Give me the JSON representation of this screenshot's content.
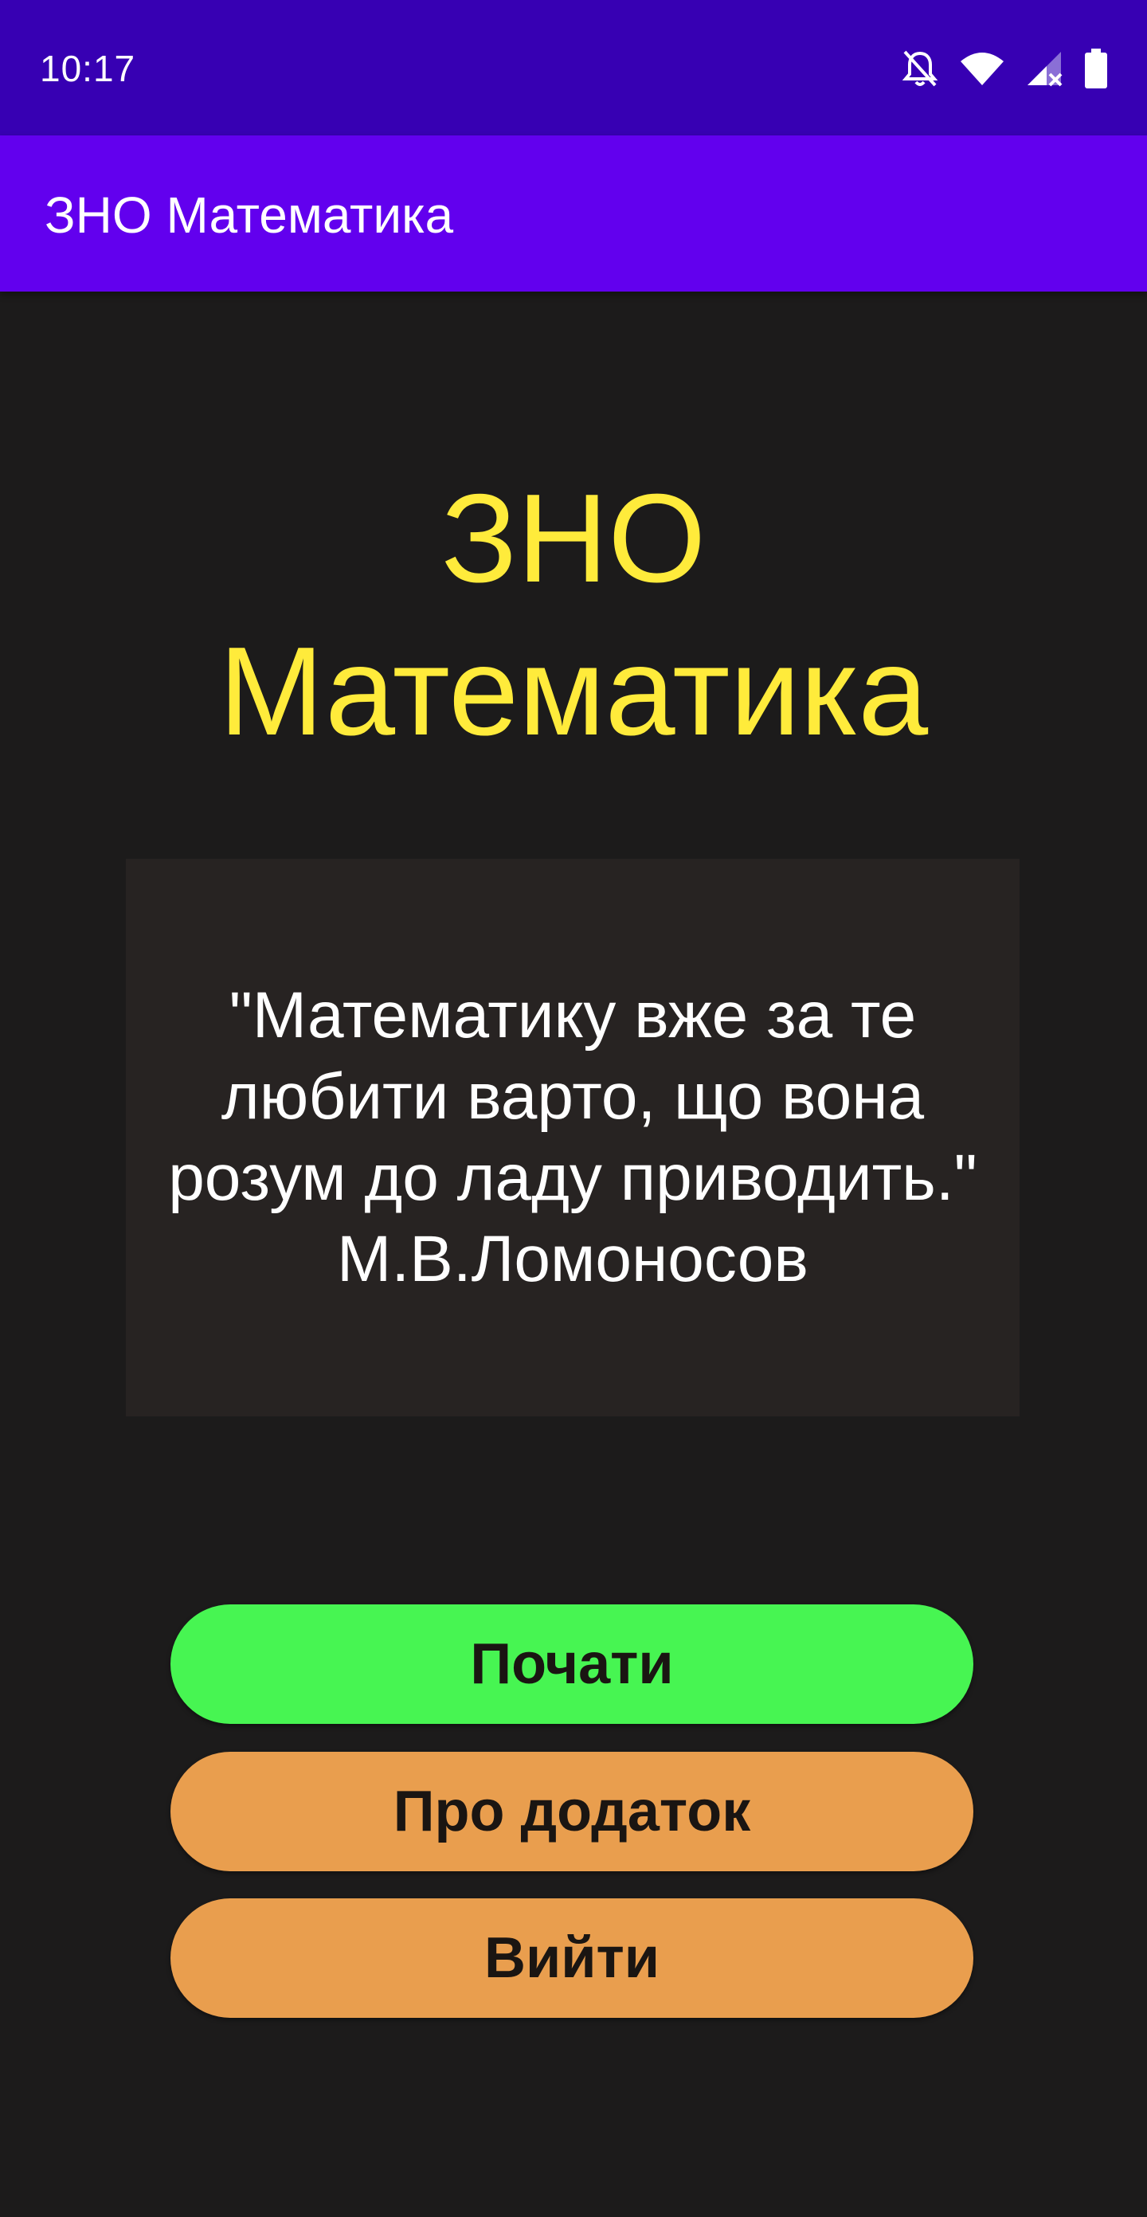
{
  "status_bar": {
    "time": "10:17",
    "icons": [
      "notifications-off-icon",
      "wifi-icon",
      "signal-no-service-icon",
      "battery-icon"
    ],
    "background": "#3700b3"
  },
  "app_bar": {
    "title": "ЗНО Математика",
    "background": "#6200ee"
  },
  "main": {
    "title_line1": "ЗНО",
    "title_line2": "Математика",
    "title_color": "#ffeb3b",
    "quote": "\"Математику вже за те\nлюбити варто, що вона\nрозум до ладу приводить.\"\nМ.В.Ломоносов"
  },
  "buttons": {
    "start_label": "Почати",
    "about_label": "Про додаток",
    "exit_label": "Вийти",
    "start_color": "#47f552",
    "secondary_color": "#e99e4e"
  }
}
